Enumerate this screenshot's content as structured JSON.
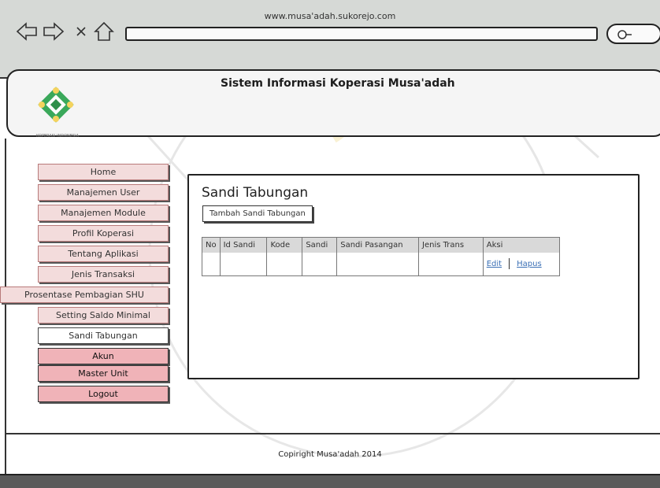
{
  "browser": {
    "url": "www.musa'adah.sukorejo.com"
  },
  "header": {
    "title": "Sistem Informasi Koperasi Musa'adah",
    "logo_caption": "KOPERASI INDONESIA"
  },
  "menu": {
    "items": [
      "Home",
      "Manajemen User",
      "Manajemen Module",
      "Profil Koperasi",
      "Tentang Aplikasi",
      "Jenis Transaksi",
      "Prosentase Pembagian SHU",
      "Setting Saldo Minimal",
      "Sandi Tabungan",
      "Akun",
      "Master Unit",
      "Logout"
    ]
  },
  "content": {
    "title": "Sandi Tabungan",
    "add_button": "Tambah Sandi Tabungan",
    "table": {
      "headers": [
        "No",
        "Id Sandi",
        "Kode",
        "Sandi",
        "Sandi Pasangan",
        "Jenis Trans",
        "Aksi"
      ],
      "actions": {
        "edit": "Edit",
        "delete": "Hapus"
      }
    }
  },
  "footer": {
    "copyright": "Copiright Musa'adah 2014"
  }
}
